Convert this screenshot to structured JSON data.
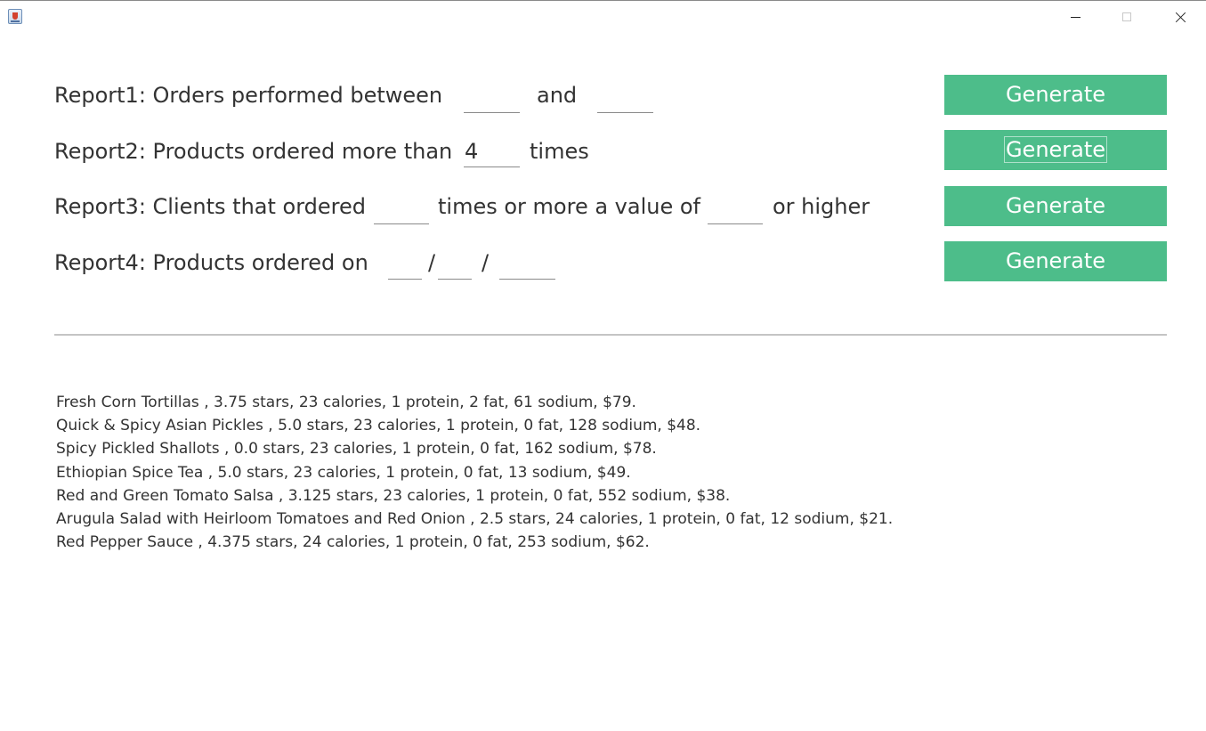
{
  "window": {
    "title": "",
    "controls": {
      "minimize": "minimize-icon",
      "maximize": "maximize-icon",
      "close": "close-icon"
    }
  },
  "reports": {
    "report1": {
      "label_prefix": "Report1: Orders performed between",
      "label_mid": "and",
      "from_value": "",
      "to_value": ""
    },
    "report2": {
      "label_prefix": "Report2: Products ordered more than",
      "count_value": "4",
      "label_suffix": "times"
    },
    "report3": {
      "label_prefix": "Report3: Clients that ordered",
      "times_value": "",
      "label_mid": "times or more a value of",
      "amount_value": "",
      "label_suffix": "or higher"
    },
    "report4": {
      "label_prefix": "Report4: Products ordered on",
      "separator": "/",
      "day_value": "",
      "month_value": "",
      "year_value": ""
    }
  },
  "buttons": {
    "generate_label": "Generate",
    "accent_color": "#4dbd8a",
    "focused_index": 2
  },
  "results": [
    "Fresh Corn Tortillas , 3.75 stars, 23 calories, 1 protein, 2 fat, 61 sodium, $79.",
    "Quick & Spicy Asian Pickles , 5.0 stars, 23 calories, 1 protein, 0 fat, 128 sodium, $48.",
    "Spicy Pickled Shallots , 0.0 stars, 23 calories, 1 protein, 0 fat, 162 sodium, $78.",
    "Ethiopian Spice Tea , 5.0 stars, 23 calories, 1 protein, 0 fat, 13 sodium, $49.",
    "Red and Green Tomato Salsa , 3.125 stars, 23 calories, 1 protein, 0 fat, 552 sodium, $38.",
    "Arugula Salad with Heirloom Tomatoes and Red Onion , 2.5 stars, 24 calories, 1 protein, 0 fat, 12 sodium, $21.",
    "Red Pepper Sauce , 4.375 stars, 24 calories, 1 protein, 0 fat, 253 sodium, $62."
  ]
}
